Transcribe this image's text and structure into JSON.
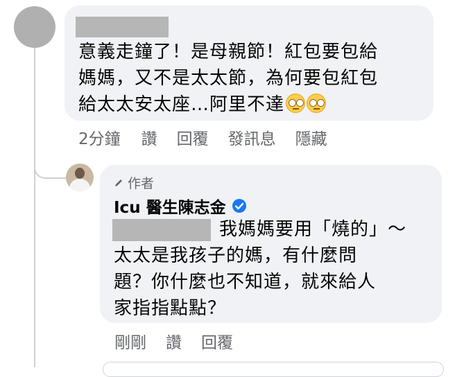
{
  "comment": {
    "text_lines": [
      "意義走鐘了！是母親節！紅包要包給",
      "媽媽，又不是太太節，為何要包紅包",
      "給太太安太座…阿里不達"
    ],
    "emojis": [
      "face-with-rolling-eyes-icon",
      "face-with-rolling-eyes-icon"
    ],
    "actions": {
      "time": "2分鐘",
      "like": "讚",
      "reply": "回覆",
      "message": "發訊息",
      "hide": "隱藏"
    }
  },
  "reply": {
    "badge": "作者",
    "author": "Icu 醫生陳志金",
    "text_lines": [
      "我媽媽要用「燒的」～",
      "太太是我孩子的媽，有什麼問",
      "題？你什麼也不知道，就來給人",
      "家指指點點？"
    ],
    "actions": {
      "time": "剛剛",
      "like": "讚",
      "reply": "回覆"
    }
  },
  "colors": {
    "bubble": "#f0f2f5",
    "meta_text": "#65676b",
    "verified": "#1877f2"
  }
}
